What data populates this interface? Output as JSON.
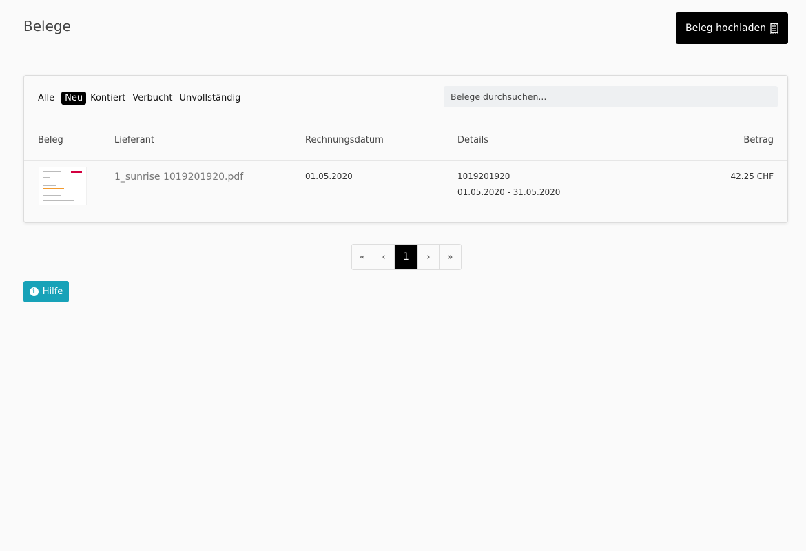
{
  "page": {
    "title": "Belege"
  },
  "toolbar": {
    "upload_label": "Beleg hochladen",
    "upload_icon": "receipt-icon"
  },
  "filters": [
    {
      "label": "Alle",
      "active": false
    },
    {
      "label": "Neu",
      "active": true
    },
    {
      "label": "Kontiert",
      "active": false
    },
    {
      "label": "Verbucht",
      "active": false
    },
    {
      "label": "Unvollständig",
      "active": false
    }
  ],
  "search": {
    "placeholder": "Belege durchsuchen..."
  },
  "table": {
    "columns": [
      "Beleg",
      "Lieferant",
      "Rechnungsdatum",
      "Details",
      "Betrag"
    ],
    "rows": [
      {
        "supplier": "1_sunrise 1019201920.pdf",
        "invoice_date": "01.05.2020",
        "details_line1": "1019201920",
        "details_line2": "01.05.2020 - 31.05.2020",
        "amount": "42.25 CHF"
      }
    ]
  },
  "pagination": {
    "first": "«",
    "prev": "‹",
    "current": "1",
    "next": "›",
    "last": "»"
  },
  "help": {
    "label": "Hilfe",
    "icon": "info-icon"
  },
  "colors": {
    "accent": "#000000",
    "help": "#17a2b8",
    "background": "#fafafa"
  }
}
